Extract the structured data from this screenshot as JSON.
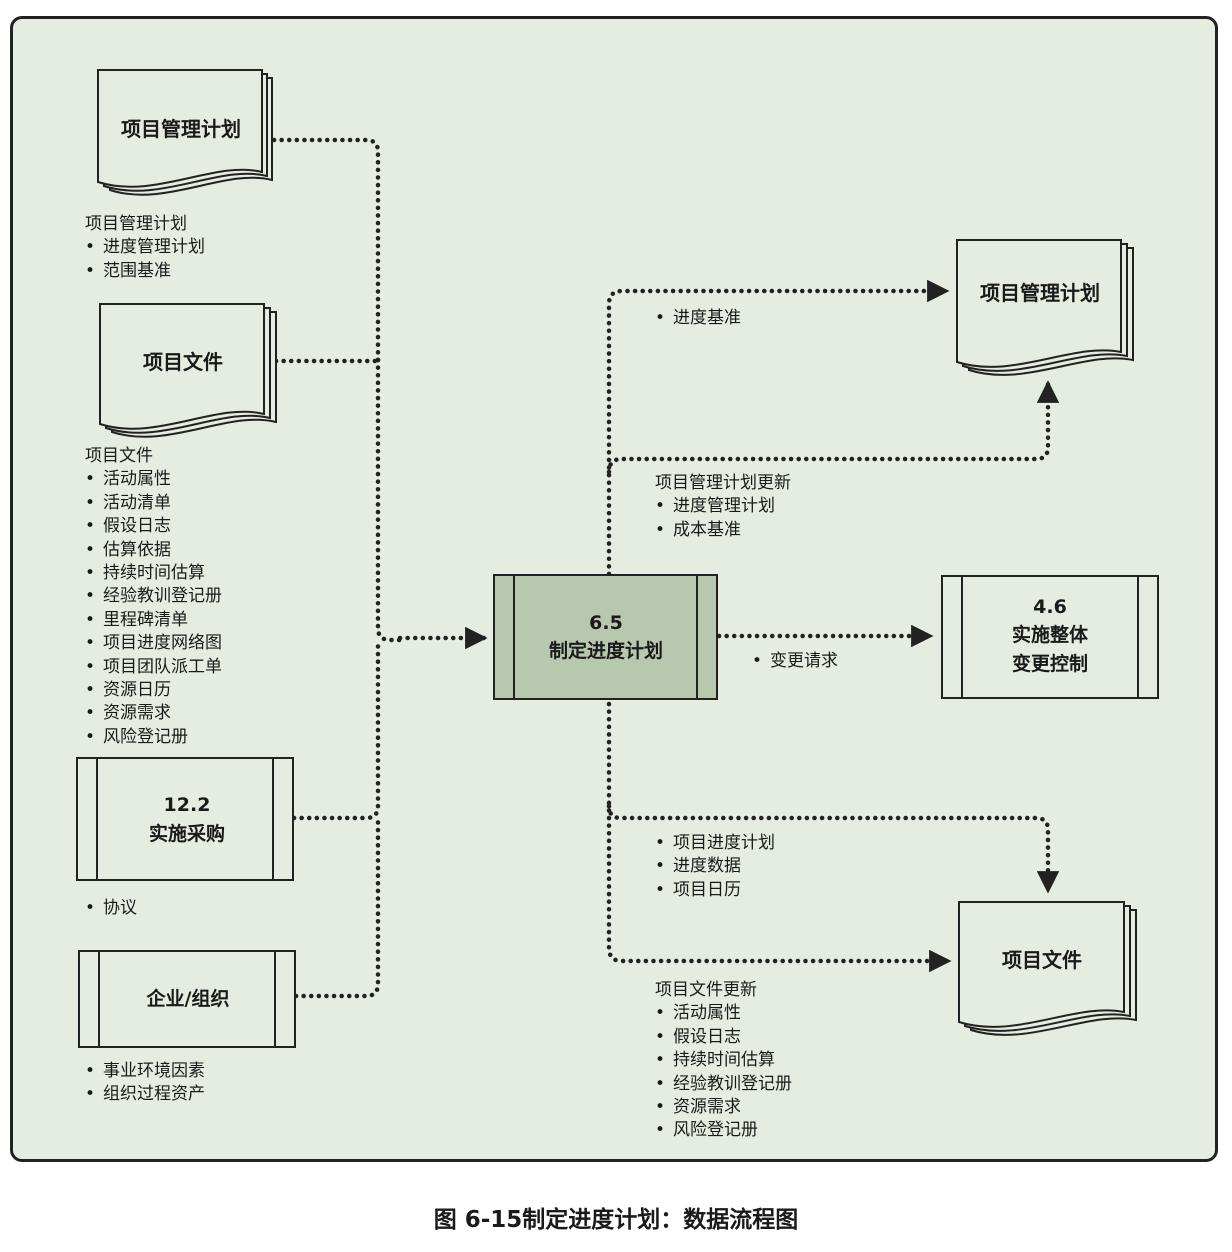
{
  "inputs": {
    "pm_plan": {
      "title": "项目管理计划",
      "heading": "项目管理计划",
      "items": [
        "进度管理计划",
        "范围基准"
      ]
    },
    "project_docs": {
      "title": "项目文件",
      "heading": "项目文件",
      "items": [
        "活动属性",
        "活动清单",
        "假设日志",
        "估算依据",
        "持续时间估算",
        "经验教训登记册",
        "里程碑清单",
        "项目进度网络图",
        "项目团队派工单",
        "资源日历",
        "资源需求",
        "风险登记册"
      ]
    },
    "procurement": {
      "number": "12.2",
      "title": "实施采购",
      "items": [
        "协议"
      ]
    },
    "enterprise": {
      "title": "企业/组织",
      "items": [
        "事业环境因素",
        "组织过程资产"
      ]
    }
  },
  "process": {
    "number": "6.5",
    "title": "制定进度计划"
  },
  "outputs": {
    "pm_plan": {
      "title": "项目管理计划",
      "baseline_items": [
        "进度基准"
      ],
      "updates_heading": "项目管理计划更新",
      "updates_items": [
        "进度管理计划",
        "成本基准"
      ]
    },
    "integrated_change": {
      "number": "4.6",
      "line1": "实施整体",
      "line2": "变更控制",
      "items": [
        "变更请求"
      ]
    },
    "project_docs": {
      "title": "项目文件",
      "items": [
        "项目进度计划",
        "进度数据",
        "项目日历"
      ],
      "updates_heading": "项目文件更新",
      "updates_items": [
        "活动属性",
        "假设日志",
        "持续时间估算",
        "经验教训登记册",
        "资源需求",
        "风险登记册"
      ]
    }
  },
  "caption": "图 6-15制定进度计划：数据流程图",
  "colors": {
    "background": "#e4eddf",
    "process_fill": "#b7c8ae",
    "stroke": "#222222"
  }
}
